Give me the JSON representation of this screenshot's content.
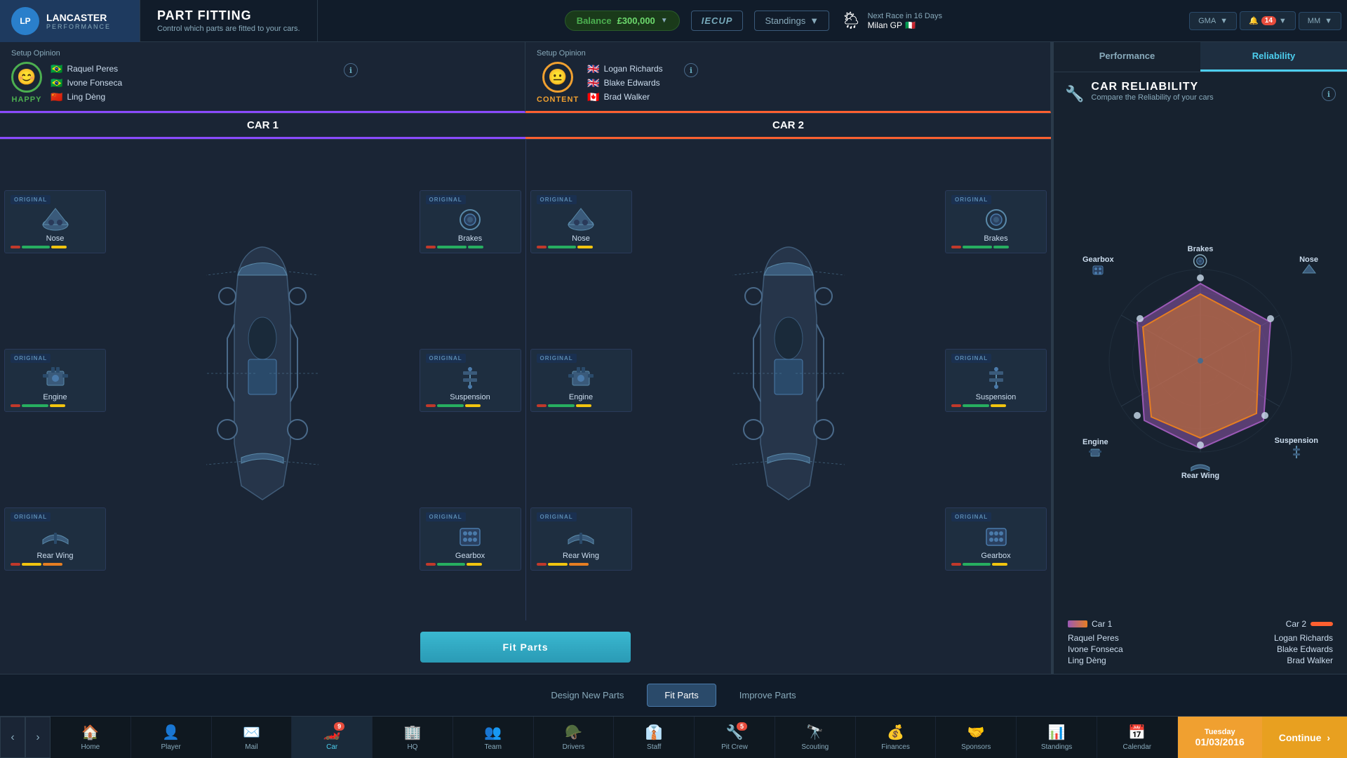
{
  "app": {
    "logo_initials": "LP",
    "company_name": "LANCASTER",
    "company_sub": "PERFORMANCE",
    "page_title": "PART FITTING",
    "page_subtitle": "Control which parts are fitted to your cars."
  },
  "topbar": {
    "balance_label": "Balance",
    "balance_value": "£300,000",
    "series_name": "IECUP",
    "standings_label": "Standings",
    "weather_icon": "🌦",
    "next_race_label": "Next Race in 16 Days",
    "race_name": "Milan GP",
    "race_flag": "🇮🇹",
    "gma_label": "GMA",
    "notifications_count": "14",
    "profile_initials": "MM"
  },
  "car1": {
    "title": "CAR 1",
    "setup_label": "Setup Opinion",
    "mood": "HAPPY",
    "mood_emoji": "😊",
    "mood_color": "#4caf50",
    "drivers": [
      {
        "name": "Raquel Peres",
        "flag": "🇧🇷"
      },
      {
        "name": "Ivone Fonseca",
        "flag": "🇧🇷"
      },
      {
        "name": "Ling Dèng",
        "flag": "🇨🇳"
      }
    ],
    "parts": {
      "left": [
        {
          "badge": "ORIGINAL",
          "icon": "👃",
          "name": "Nose",
          "bars": [
            "r",
            "g",
            "y"
          ]
        },
        {
          "badge": "ORIGINAL",
          "icon": "⚙️",
          "name": "Engine",
          "bars": [
            "r",
            "g",
            "y"
          ]
        },
        {
          "badge": "ORIGINAL",
          "icon": "🛩️",
          "name": "Rear Wing",
          "bars": [
            "r",
            "y",
            "o"
          ]
        }
      ],
      "right": [
        {
          "badge": "ORIGINAL",
          "icon": "🔵",
          "name": "Brakes",
          "bars": [
            "r",
            "g",
            "g"
          ]
        },
        {
          "badge": "ORIGINAL",
          "icon": "🔩",
          "name": "Suspension",
          "bars": [
            "r",
            "g",
            "y"
          ]
        },
        {
          "badge": "ORIGINAL",
          "icon": "⚙️",
          "name": "Gearbox",
          "bars": [
            "r",
            "g",
            "y"
          ]
        }
      ]
    }
  },
  "car2": {
    "title": "CAR 2",
    "setup_label": "Setup Opinion",
    "mood": "CONTENT",
    "mood_emoji": "😐",
    "mood_color": "#f0a030",
    "drivers": [
      {
        "name": "Logan Richards",
        "flag": "🇬🇧"
      },
      {
        "name": "Blake Edwards",
        "flag": "🇬🇧"
      },
      {
        "name": "Brad Walker",
        "flag": "🇨🇦"
      }
    ],
    "parts": {
      "left": [
        {
          "badge": "ORIGINAL",
          "icon": "👃",
          "name": "Nose",
          "bars": [
            "r",
            "g",
            "y"
          ]
        },
        {
          "badge": "ORIGINAL",
          "icon": "⚙️",
          "name": "Engine",
          "bars": [
            "r",
            "g",
            "y"
          ]
        },
        {
          "badge": "ORIGINAL",
          "icon": "🛩️",
          "name": "Rear Wing",
          "bars": [
            "r",
            "y",
            "o"
          ]
        }
      ],
      "right": [
        {
          "badge": "ORIGINAL",
          "icon": "🔵",
          "name": "Brakes",
          "bars": [
            "r",
            "g",
            "g"
          ]
        },
        {
          "badge": "ORIGINAL",
          "icon": "🔩",
          "name": "Suspension",
          "bars": [
            "r",
            "g",
            "y"
          ]
        },
        {
          "badge": "ORIGINAL",
          "icon": "⚙️",
          "name": "Gearbox",
          "bars": [
            "r",
            "g",
            "y"
          ]
        }
      ]
    }
  },
  "fit_parts_btn": "Fit Parts",
  "right_panel": {
    "tab_performance": "Performance",
    "tab_reliability": "Reliability",
    "title": "CAR RELIABILITY",
    "subtitle": "Compare the Reliability of your cars",
    "labels": {
      "brakes": "Brakes",
      "nose": "Nose",
      "suspension": "Suspension",
      "rear_wing": "Rear Wing",
      "engine": "Engine",
      "gearbox": "Gearbox"
    },
    "car1_label": "Car 1",
    "car2_label": "Car 2",
    "car1_drivers": [
      "Raquel Peres",
      "Ivone Fonseca",
      "Ling Dèng"
    ],
    "car2_drivers": [
      "Logan Richards",
      "Blake Edwards",
      "Brad Walker"
    ]
  },
  "bottom_tabs": [
    {
      "id": "design",
      "label": "Design New Parts",
      "active": false
    },
    {
      "id": "fit",
      "label": "Fit Parts",
      "active": true
    },
    {
      "id": "improve",
      "label": "Improve Parts",
      "active": false
    }
  ],
  "nav": [
    {
      "id": "home",
      "icon": "🏠",
      "label": "Home",
      "active": false,
      "badge": null
    },
    {
      "id": "player",
      "icon": "👤",
      "label": "Player",
      "active": false,
      "badge": null
    },
    {
      "id": "mail",
      "icon": "✉️",
      "label": "Mail",
      "active": false,
      "badge": null
    },
    {
      "id": "car",
      "icon": "🏎️",
      "label": "Car",
      "active": true,
      "badge": "9"
    },
    {
      "id": "hq",
      "icon": "🏢",
      "label": "HQ",
      "active": false,
      "badge": null
    },
    {
      "id": "team",
      "icon": "👥",
      "label": "Team",
      "active": false,
      "badge": null
    },
    {
      "id": "drivers",
      "icon": "🪖",
      "label": "Drivers",
      "active": false,
      "badge": null
    },
    {
      "id": "staff",
      "icon": "👔",
      "label": "Staff",
      "active": false,
      "badge": null
    },
    {
      "id": "pit_crew",
      "icon": "🔧",
      "label": "Pit Crew",
      "active": false,
      "badge": "5"
    },
    {
      "id": "scouting",
      "icon": "🔭",
      "label": "Scouting",
      "active": false,
      "badge": null
    },
    {
      "id": "finances",
      "icon": "💰",
      "label": "Finances",
      "active": false,
      "badge": null
    },
    {
      "id": "sponsors",
      "icon": "🤝",
      "label": "Sponsors",
      "active": false,
      "badge": null
    },
    {
      "id": "standings",
      "icon": "📊",
      "label": "Standings",
      "active": false,
      "badge": null
    },
    {
      "id": "calendar",
      "icon": "📅",
      "label": "Calendar",
      "active": false,
      "badge": null
    }
  ],
  "date": {
    "day": "Tuesday",
    "date": "01/03/2016"
  },
  "continue_btn": "Continue"
}
